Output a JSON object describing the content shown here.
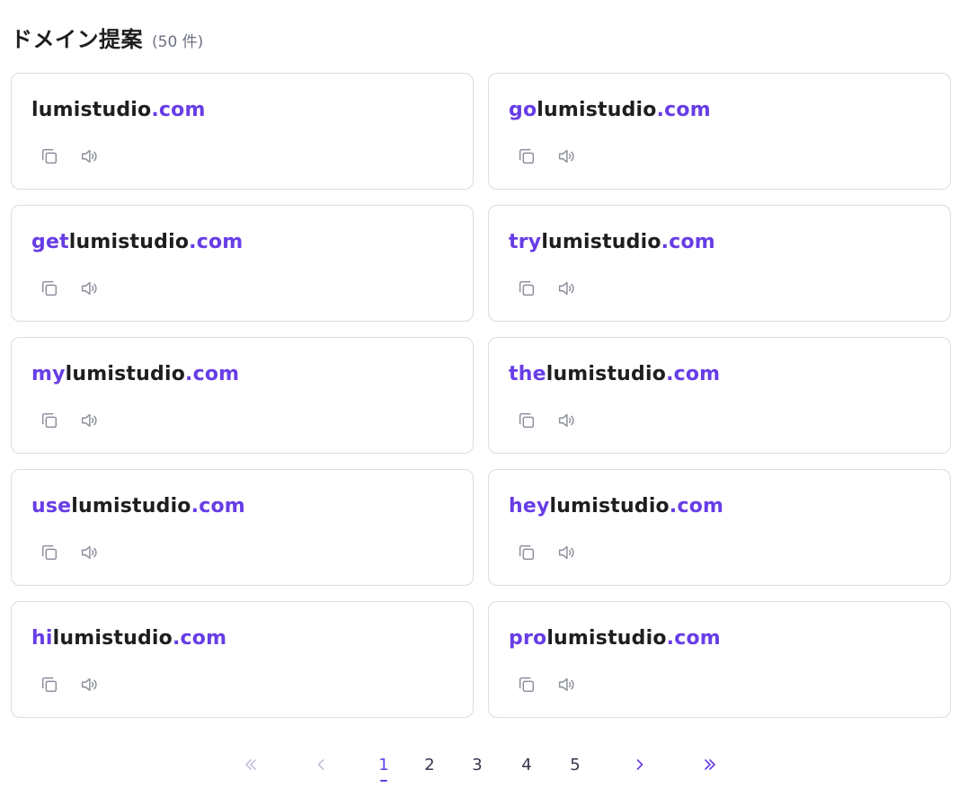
{
  "header": {
    "title": "ドメイン提案",
    "count": "(50 件)"
  },
  "cards": [
    {
      "prefix": "",
      "base": "lumistudio",
      "tld": ".com"
    },
    {
      "prefix": "go",
      "base": "lumistudio",
      "tld": ".com"
    },
    {
      "prefix": "get",
      "base": "lumistudio",
      "tld": ".com"
    },
    {
      "prefix": "try",
      "base": "lumistudio",
      "tld": ".com"
    },
    {
      "prefix": "my",
      "base": "lumistudio",
      "tld": ".com"
    },
    {
      "prefix": "the",
      "base": "lumistudio",
      "tld": ".com"
    },
    {
      "prefix": "use",
      "base": "lumistudio",
      "tld": ".com"
    },
    {
      "prefix": "hey",
      "base": "lumistudio",
      "tld": ".com"
    },
    {
      "prefix": "hi",
      "base": "lumistudio",
      "tld": ".com"
    },
    {
      "prefix": "pro",
      "base": "lumistudio",
      "tld": ".com"
    }
  ],
  "card_actions": {
    "copy_icon": "copy-icon",
    "speaker_icon": "speaker-icon"
  },
  "pagination": {
    "pages": [
      "1",
      "2",
      "3",
      "4",
      "5"
    ],
    "current": "1"
  },
  "colors": {
    "accent": "#673de6",
    "text": "#1d1e20",
    "muted": "#6d7081",
    "border": "#dadce0",
    "icon": "#8c8f9c",
    "disabled": "#c5c2dc"
  }
}
